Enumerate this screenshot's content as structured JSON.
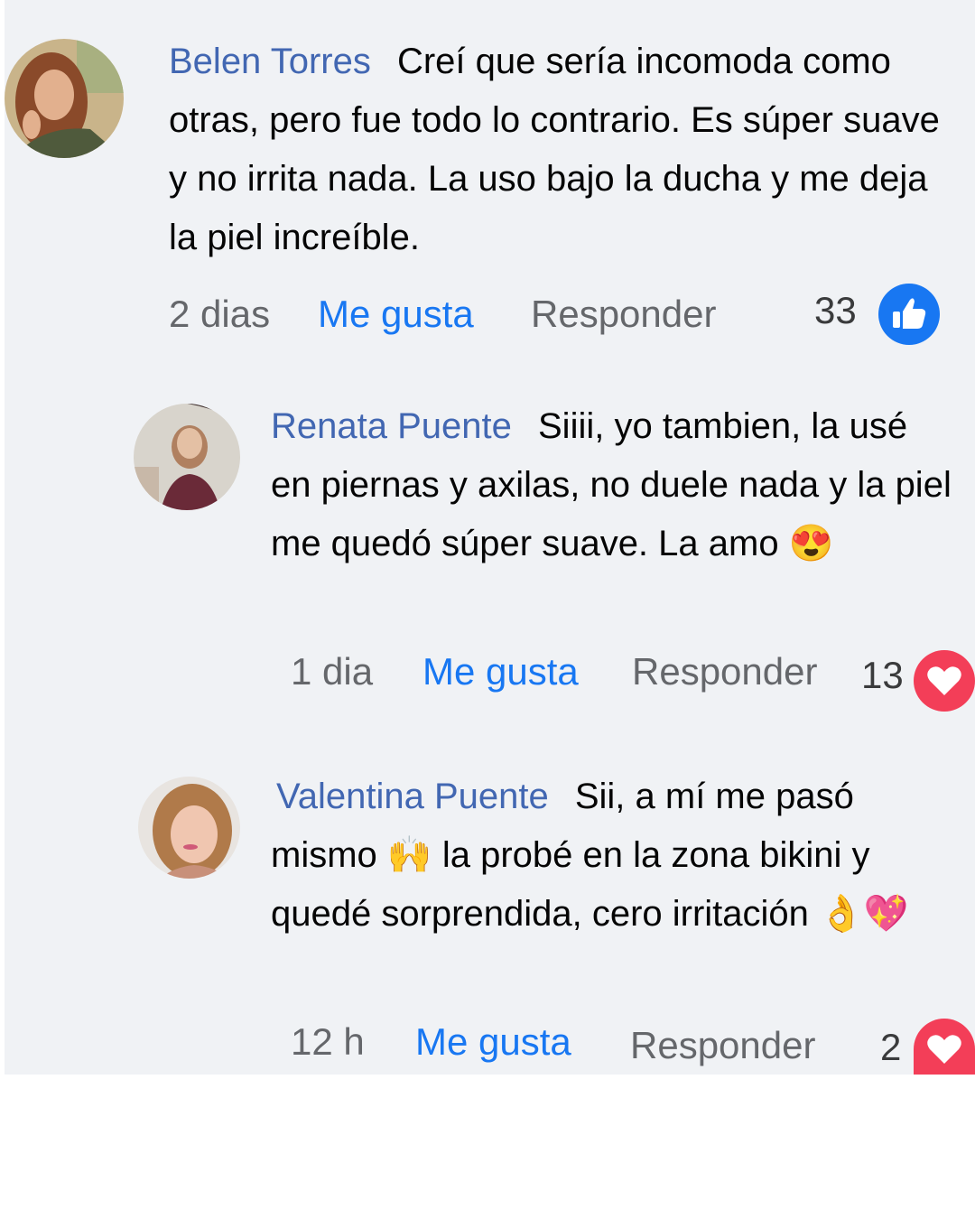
{
  "comments": [
    {
      "name": "Belen Torres",
      "text": "Creí que sería incomoda como otras, pero fue todo lo contrario. Es súper suave y no irrita nada. La uso bajo la ducha y me deja la piel increíble.",
      "emoji": "",
      "time": "2 dias",
      "like_label": "Me gusta",
      "reply_label": "Responder",
      "reactions": "33",
      "reaction_type": "like-icon",
      "reaction_color": "#1877f2"
    },
    {
      "name": "Renata Puente",
      "text": "Siiii, yo tambien, la usé en piernas y axilas, no duele nada y la piel me quedó súper suave. La amo",
      "emoji": "😍",
      "time": "1 dia",
      "like_label": "Me gusta",
      "reply_label": "Responder",
      "reactions": "13",
      "reaction_type": "heart-icon",
      "reaction_color": "#f33e58"
    },
    {
      "name": "Valentina Puente",
      "text_a": "Sii, a mí me pasó mismo",
      "emoji_a": "🙌",
      "text_b": "la probé en la zona bikini y quedé sorprendida, cero irritación",
      "emoji_b": "👌💖",
      "time": "12 h",
      "like_label": "Me gusta",
      "reply_label": "Responder",
      "reactions": "2",
      "reaction_type": "heart-icon",
      "reaction_color": "#f33e58"
    }
  ]
}
